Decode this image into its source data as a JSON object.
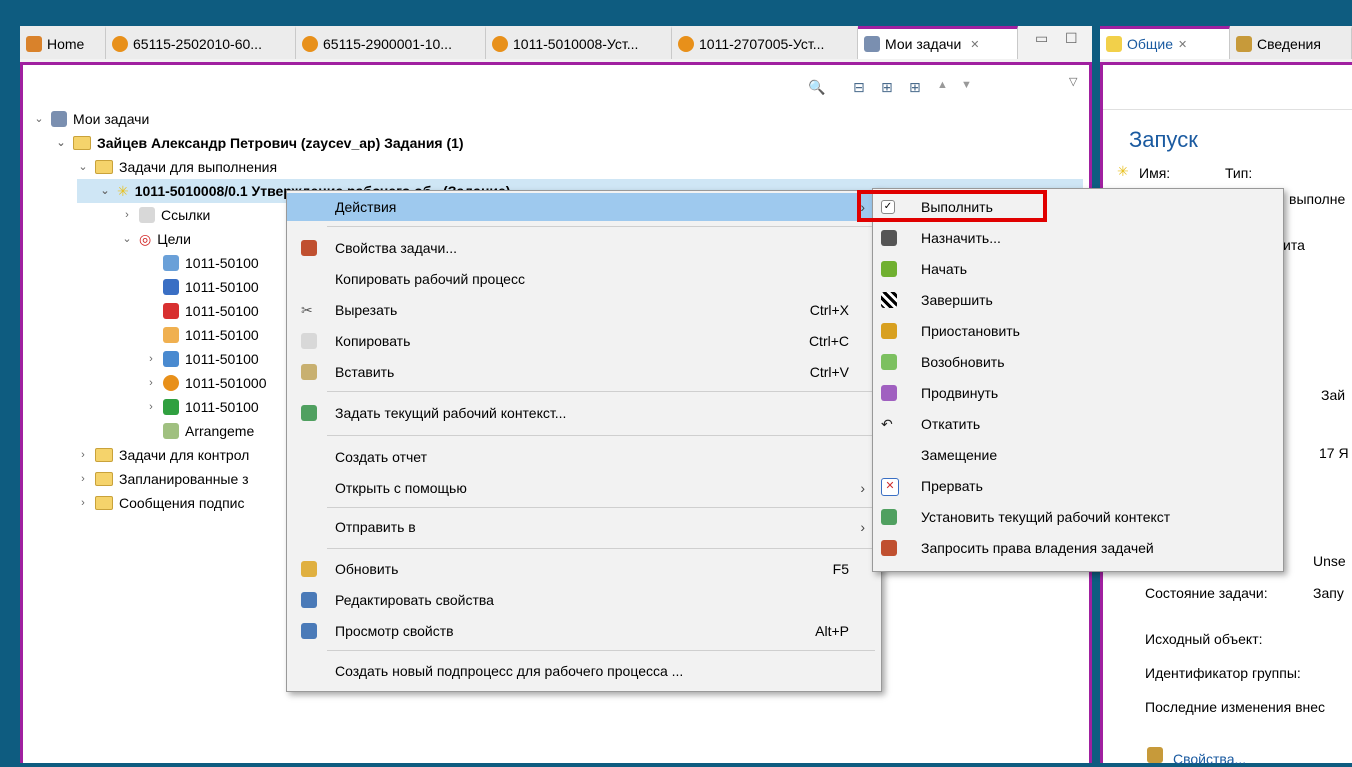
{
  "tabs": [
    {
      "label": "Home",
      "color": "#d9822b"
    },
    {
      "label": "65115-2502010-60...",
      "color": "#e8901a"
    },
    {
      "label": "65115-2900001-10...",
      "color": "#e8901a"
    },
    {
      "label": "1011-5010008-Уст...",
      "color": "#e8901a"
    },
    {
      "label": "1011-2707005-Уст...",
      "color": "#e8901a"
    },
    {
      "label": "Мои задачи",
      "close": "✕"
    }
  ],
  "right_tabs": [
    {
      "label": "Общие",
      "close": "✕"
    },
    {
      "label": "Сведения"
    }
  ],
  "tree": {
    "root": "Мои задачи",
    "user": "Зайцев Александр Петрович (zaycev_ap) Задания (1)",
    "folder_exec": "Задачи для выполнения",
    "task": "1011-5010008/0.1 Утверждение рабочего об...(Задание)",
    "links": "Ссылки",
    "goals": "Цели",
    "items": [
      "1011-50100",
      "1011-50100",
      "1011-50100",
      "1011-50100",
      "1011-50100",
      "1011-501000",
      "1011-50100",
      "Arrangeme"
    ],
    "folders": [
      "Задачи для контрол",
      "Запланированные з",
      "Сообщения подпис"
    ]
  },
  "context_menu": {
    "items": [
      {
        "label": "Действия",
        "submenu": true
      },
      {
        "label": "Свойства задачи..."
      },
      {
        "label": "Копировать рабочий процесс"
      },
      {
        "label": "Вырезать",
        "shortcut": "Ctrl+X"
      },
      {
        "label": "Копировать",
        "shortcut": "Ctrl+C"
      },
      {
        "label": "Вставить",
        "shortcut": "Ctrl+V"
      },
      {
        "label": "Задать текущий рабочий контекст..."
      },
      {
        "label": "Создать отчет"
      },
      {
        "label": "Открыть с помощью",
        "submenu": true
      },
      {
        "label": "Отправить в",
        "submenu": true
      },
      {
        "label": "Обновить",
        "shortcut": "F5"
      },
      {
        "label": "Редактировать свойства"
      },
      {
        "label": "Просмотр свойств",
        "shortcut": "Alt+P"
      },
      {
        "label": "Создать новый подпроцесс для рабочего процесса ..."
      }
    ]
  },
  "submenu": {
    "items": [
      {
        "label": "Выполнить",
        "icon": "check-icon"
      },
      {
        "label": "Назначить...",
        "icon": "assign-icon"
      },
      {
        "label": "Начать",
        "icon": "traffic-light-icon"
      },
      {
        "label": "Завершить",
        "icon": "finish-flag-icon"
      },
      {
        "label": "Приостановить",
        "icon": "traffic-light-icon"
      },
      {
        "label": "Возобновить",
        "icon": "resume-icon"
      },
      {
        "label": "Продвинуть",
        "icon": "promote-icon"
      },
      {
        "label": "Откатить",
        "icon": "undo-icon"
      },
      {
        "label": "Замещение",
        "icon": ""
      },
      {
        "label": "Прервать",
        "icon": "abort-icon"
      },
      {
        "label": "Установить текущий рабочий контекст",
        "icon": "context-icon"
      },
      {
        "label": "Запросить права владения задачей",
        "icon": "ownership-icon"
      }
    ]
  },
  "details": {
    "title": "Запуск",
    "name_label": "Имя:",
    "type_label": "Тип:",
    "frag_exec": "выполне",
    "frag_ita": "ита",
    "frag_zai": "Зай",
    "frag_date": "17 Я",
    "frag_uns": "Unse",
    "state_label": "Состояние задачи:",
    "state_val": "Запу",
    "source_label": "Исходный объект:",
    "group_label": "Идентификатор группы:",
    "last_label": "Последние изменения внес",
    "props_link": "Свойства..."
  },
  "colors": {
    "accent": "#a020a0",
    "highlight": "#e00000",
    "selected_row": "#cfe6f5",
    "menu_hover": "#9ec9ee"
  }
}
